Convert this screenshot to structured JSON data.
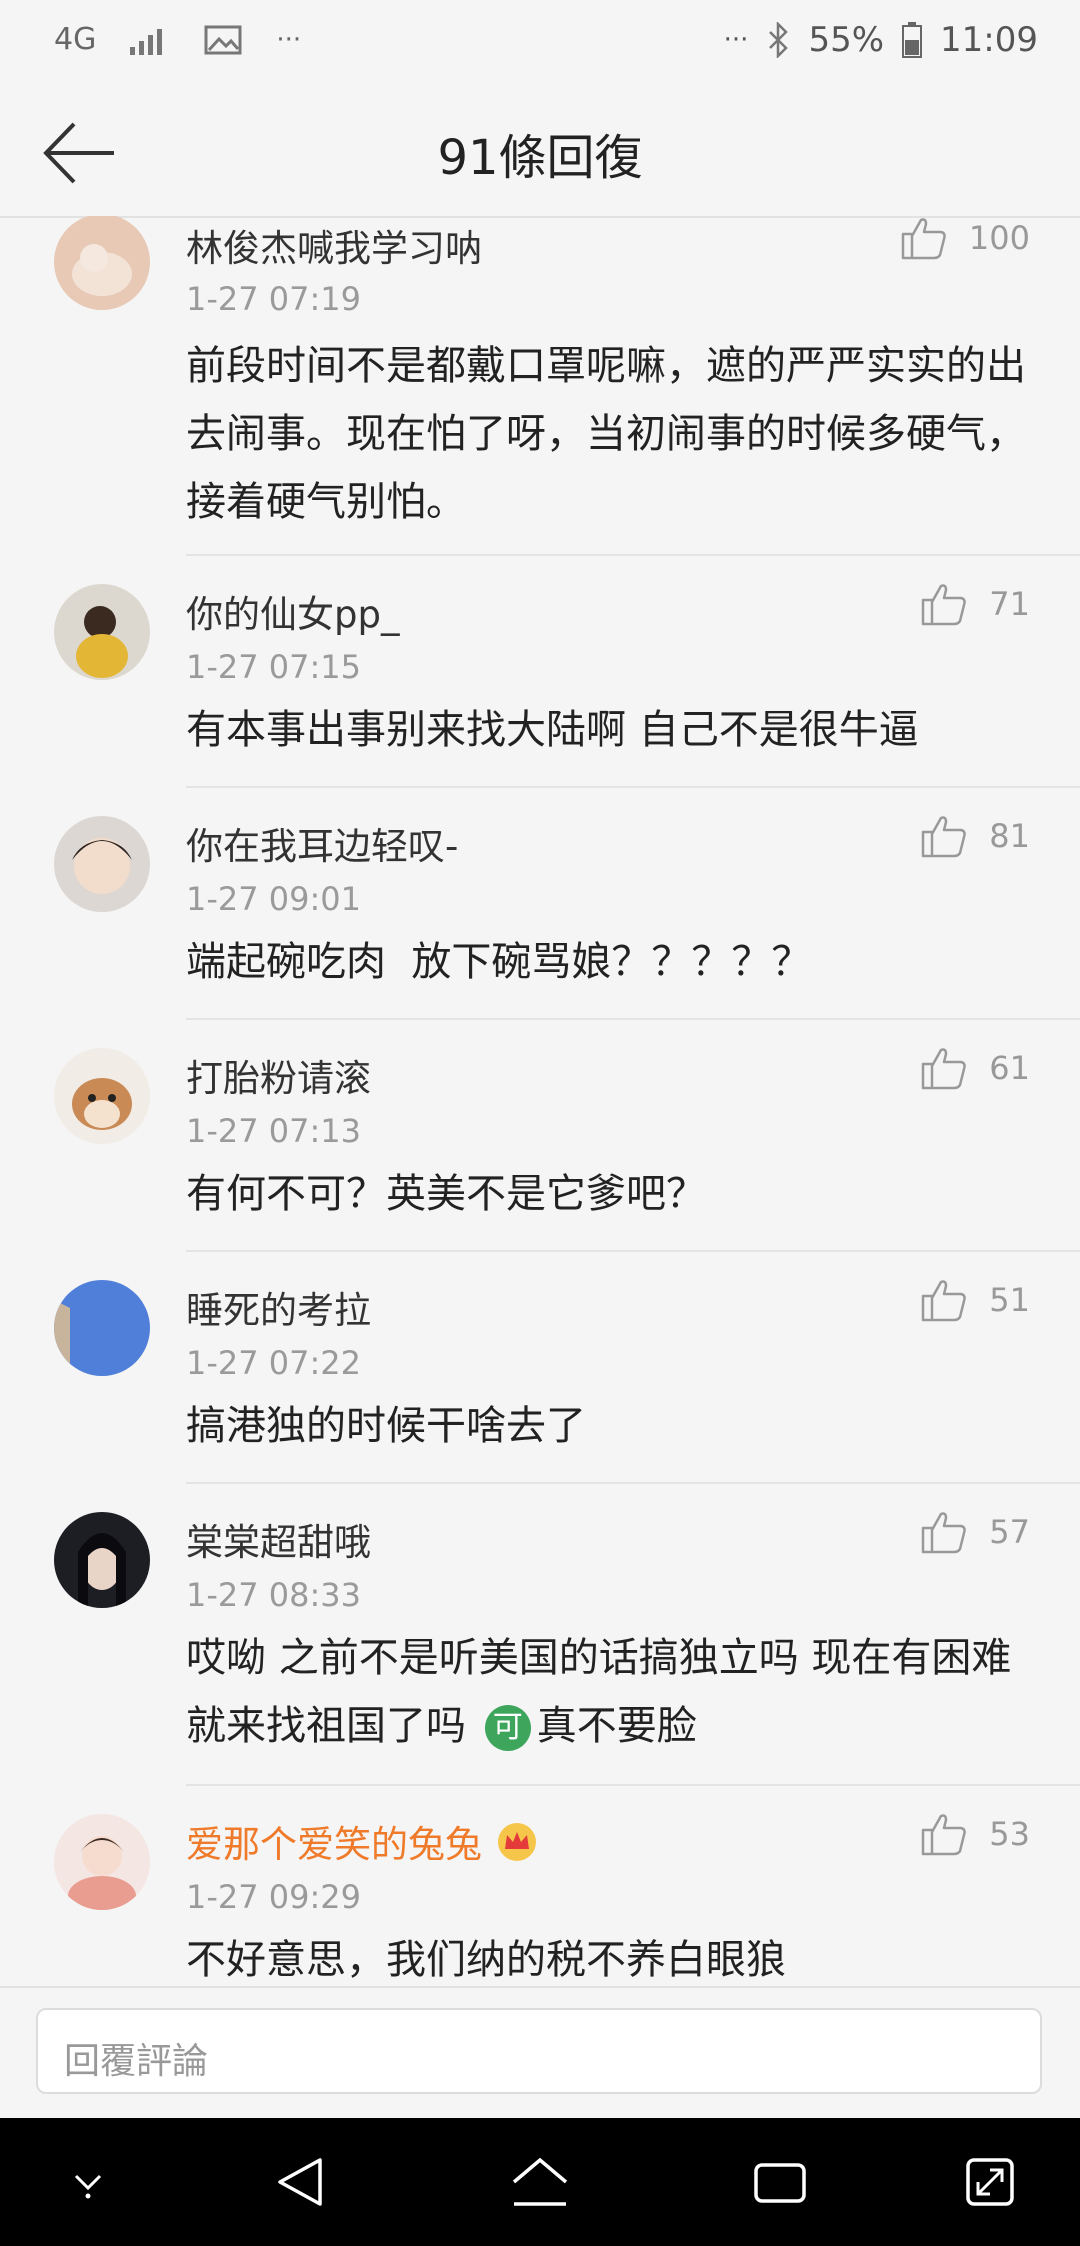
{
  "status_bar": {
    "network": "4G",
    "dots_left": "···",
    "dots_right": "···",
    "battery": "55%",
    "time": "11:09"
  },
  "header": {
    "title": "91條回復"
  },
  "comments": [
    {
      "name": "林俊杰喊我学习呐",
      "date": "1-27 07:19",
      "likes": "100",
      "text": "前段时间不是都戴口罩呢嘛，遮的严严实实的出去闹事。现在怕了呀，当初闹事的时候多硬气，接着硬气别怕。",
      "avatar_color": "#e8c9b5"
    },
    {
      "name": "你的仙女pp_",
      "date": "1-27 07:15",
      "likes": "71",
      "text": "有本事出事别来找大陆啊 自己不是很牛逼",
      "avatar_color": "#d9b04a"
    },
    {
      "name": "你在我耳边轻叹-",
      "date": "1-27 09:01",
      "likes": "81",
      "text": "端起碗吃肉  放下碗骂娘？？？？？",
      "avatar_color": "#c9c3bd"
    },
    {
      "name": "打胎粉请滚",
      "date": "1-27 07:13",
      "likes": "61",
      "text": "有何不可？英美不是它爹吧？",
      "avatar_color": "#d7a57c"
    },
    {
      "name": "睡死的考拉",
      "date": "1-27 07:22",
      "likes": "51",
      "text": "搞港独的时候干啥去了",
      "avatar_color": "#4f7fd9"
    },
    {
      "name": "棠棠超甜哦",
      "date": "1-27 08:33",
      "likes": "57",
      "text_before": "哎呦 之前不是听美国的话搞独立吗 现在有困难就来找祖国了吗 ",
      "emoji": "可",
      "text_after": "真不要脸",
      "avatar_color": "#1d1d24"
    },
    {
      "name": "爱那个爱笑的兔兔",
      "date": "1-27 09:29",
      "likes": "53",
      "text": "不好意思，我们纳的税不养白眼狼",
      "avatar_color": "#e9b8b0"
    }
  ],
  "reply": {
    "placeholder": "回覆評論"
  },
  "colors": {
    "vip_name": "#ef7a2a",
    "background": "#f5f5f5"
  }
}
